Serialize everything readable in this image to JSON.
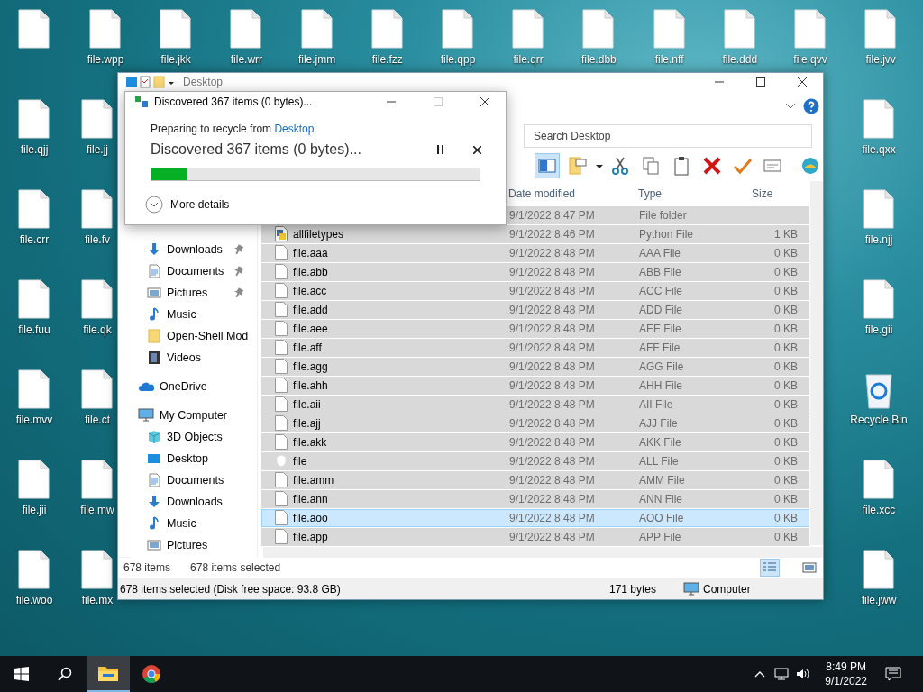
{
  "desktop": {
    "top_row": [
      {
        "label": "file.wpp"
      },
      {
        "label": "file.jkk"
      },
      {
        "label": "file.wrr"
      },
      {
        "label": "file.jmm"
      },
      {
        "label": "file.fzz"
      },
      {
        "label": "file.qpp"
      },
      {
        "label": "file.qrr"
      },
      {
        "label": "file.dbb"
      },
      {
        "label": "file.nff"
      },
      {
        "label": "file.ddd"
      },
      {
        "label": "file.qvv"
      },
      {
        "label": "file.jvv"
      }
    ],
    "left_column": [
      {
        "label": "file.qjj"
      },
      {
        "label": "file.crr"
      },
      {
        "label": "file.fuu"
      },
      {
        "label": "file.mvv"
      },
      {
        "label": "file.jii"
      },
      {
        "label": "file.woo"
      }
    ],
    "second_column": [
      {
        "label": "file.jj"
      },
      {
        "label": "file.fv"
      },
      {
        "label": "file.qk"
      },
      {
        "label": "file.ct"
      },
      {
        "label": "file.mw"
      },
      {
        "label": "file.mx"
      }
    ],
    "right_column": [
      {
        "label": "file.qxx",
        "kind": "file"
      },
      {
        "label": "file.njj",
        "kind": "file"
      },
      {
        "label": "file.gii",
        "kind": "file"
      },
      {
        "label": "Recycle Bin",
        "kind": "recycle"
      },
      {
        "label": "file.xcc",
        "kind": "file"
      },
      {
        "label": "file.jww",
        "kind": "file"
      }
    ]
  },
  "explorer": {
    "title": "Desktop",
    "search": {
      "placeholder": "Search Desktop"
    },
    "columns": [
      "Date modified",
      "Type",
      "Size"
    ],
    "rows": [
      {
        "date": "9/1/2022 8:47 PM",
        "type": "File folder",
        "selected": true,
        "focused": false
      },
      {
        "name": "allfiletypes",
        "kind": "python",
        "date": "9/1/2022 8:46 PM",
        "type": "Python File",
        "size": "1 KB",
        "selected": true,
        "focused": false
      },
      {
        "name": "file.aaa",
        "kind": "file",
        "date": "9/1/2022 8:48 PM",
        "type": "AAA File",
        "size": "0 KB",
        "selected": true,
        "focused": false
      },
      {
        "name": "file.abb",
        "kind": "file",
        "date": "9/1/2022 8:48 PM",
        "type": "ABB File",
        "size": "0 KB",
        "selected": true,
        "focused": false
      },
      {
        "name": "file.acc",
        "kind": "file",
        "date": "9/1/2022 8:48 PM",
        "type": "ACC File",
        "size": "0 KB",
        "selected": true,
        "focused": false
      },
      {
        "name": "file.add",
        "kind": "file",
        "date": "9/1/2022 8:48 PM",
        "type": "ADD File",
        "size": "0 KB",
        "selected": true,
        "focused": false
      },
      {
        "name": "file.aee",
        "kind": "file",
        "date": "9/1/2022 8:48 PM",
        "type": "AEE File",
        "size": "0 KB",
        "selected": true,
        "focused": false
      },
      {
        "name": "file.aff",
        "kind": "file",
        "date": "9/1/2022 8:48 PM",
        "type": "AFF File",
        "size": "0 KB",
        "selected": true,
        "focused": false
      },
      {
        "name": "file.agg",
        "kind": "file",
        "date": "9/1/2022 8:48 PM",
        "type": "AGG File",
        "size": "0 KB",
        "selected": true,
        "focused": false
      },
      {
        "name": "file.ahh",
        "kind": "file",
        "date": "9/1/2022 8:48 PM",
        "type": "AHH File",
        "size": "0 KB",
        "selected": true,
        "focused": false
      },
      {
        "name": "file.aii",
        "kind": "file",
        "date": "9/1/2022 8:48 PM",
        "type": "AII File",
        "size": "0 KB",
        "selected": true,
        "focused": false
      },
      {
        "name": "file.ajj",
        "kind": "file",
        "date": "9/1/2022 8:48 PM",
        "type": "AJJ File",
        "size": "0 KB",
        "selected": true,
        "focused": false
      },
      {
        "name": "file.akk",
        "kind": "file",
        "date": "9/1/2022 8:48 PM",
        "type": "AKK File",
        "size": "0 KB",
        "selected": true,
        "focused": false
      },
      {
        "name": "file",
        "kind": "shield",
        "date": "9/1/2022 8:48 PM",
        "type": "ALL File",
        "size": "0 KB",
        "selected": true,
        "focused": false
      },
      {
        "name": "file.amm",
        "kind": "file",
        "date": "9/1/2022 8:48 PM",
        "type": "AMM File",
        "size": "0 KB",
        "selected": true,
        "focused": false
      },
      {
        "name": "file.ann",
        "kind": "file",
        "date": "9/1/2022 8:48 PM",
        "type": "ANN File",
        "size": "0 KB",
        "selected": true,
        "focused": false
      },
      {
        "name": "file.aoo",
        "kind": "file",
        "date": "9/1/2022 8:48 PM",
        "type": "AOO File",
        "size": "0 KB",
        "selected": true,
        "focused": true
      },
      {
        "name": "file.app",
        "kind": "file",
        "date": "9/1/2022 8:48 PM",
        "type": "APP File",
        "size": "0 KB",
        "selected": true,
        "focused": false
      }
    ],
    "navigation": [
      {
        "children": [
          {
            "label": "Downloads",
            "kind": "download",
            "pinned": true
          },
          {
            "label": "Documents",
            "kind": "document",
            "pinned": true
          },
          {
            "label": "Pictures",
            "kind": "picture",
            "pinned": true
          },
          {
            "label": "Music",
            "kind": "music",
            "pinned": false
          },
          {
            "label": "Open-Shell Mod",
            "kind": "folder",
            "pinned": false
          },
          {
            "label": "Videos",
            "kind": "video",
            "pinned": false
          }
        ]
      },
      {
        "label": "OneDrive",
        "kind": "cloud"
      },
      {
        "label": "My Computer",
        "kind": "computer",
        "children": [
          {
            "label": "3D Objects",
            "kind": "cube"
          },
          {
            "label": "Desktop",
            "kind": "desktop"
          },
          {
            "label": "Documents",
            "kind": "document"
          },
          {
            "label": "Downloads",
            "kind": "download"
          },
          {
            "label": "Music",
            "kind": "music"
          },
          {
            "label": "Pictures",
            "kind": "picture"
          }
        ]
      }
    ],
    "item_count": "678 items",
    "selection_count": "678 items selected",
    "views": [
      {
        "kind": "details",
        "selected": true
      },
      {
        "kind": "tiles",
        "selected": false
      }
    ],
    "status_bar": {
      "selection": "678 items selected (Disk free space: 93.8 GB)",
      "size": "171 bytes",
      "location": "Computer"
    }
  },
  "progress_dialog": {
    "title": "Discovered 367 items (0 bytes)...",
    "preparing": "Preparing to recycle from ",
    "source_link": "Desktop",
    "heading": "Discovered 367 items (0 bytes)...",
    "level": 0.11,
    "more_details": "More details"
  },
  "taskbar": {
    "apps": [
      {
        "kind": "explorer",
        "selected": true
      },
      {
        "kind": "chrome",
        "selected": false
      }
    ],
    "time": "8:49 PM",
    "date": "9/1/2022"
  }
}
